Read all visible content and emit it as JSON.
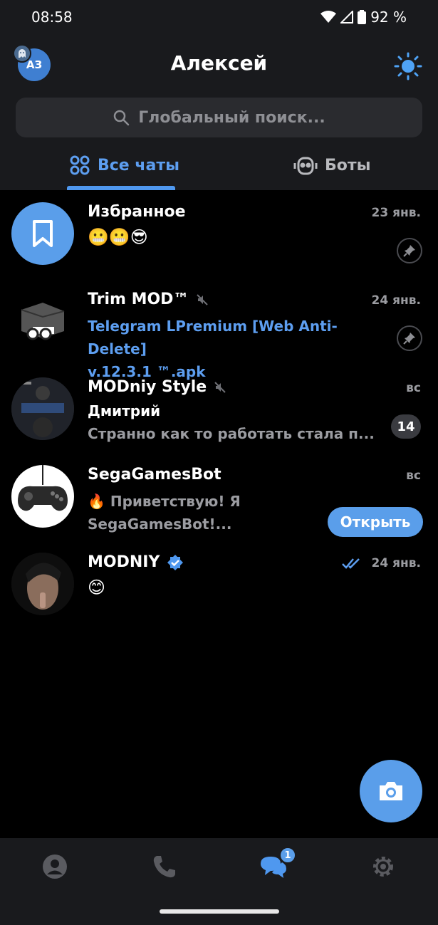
{
  "status": {
    "time": "08:58",
    "battery": "92 %"
  },
  "header": {
    "avatar_initials": "АЗ",
    "title": "Алексей"
  },
  "search": {
    "placeholder": "Глобальный поиск..."
  },
  "tabs": [
    {
      "label": "Все чаты",
      "active": true
    },
    {
      "label": "Боты",
      "active": false
    }
  ],
  "chats": [
    {
      "name": "Избранное",
      "date": "23 янв.",
      "preview": "😬😬😎",
      "pinned": true
    },
    {
      "name": "Trim MOD™",
      "date": "24 янв.",
      "muted": true,
      "pinned": true,
      "preview_line1": "Telegram LPremium [Web Anti-Delete]",
      "preview_line2": "v.12.3.1 ™.apk"
    },
    {
      "name": "MODniy Style",
      "date": "вс",
      "muted": true,
      "sender": "Дмитрий",
      "preview": "Странно как то работать стала п...",
      "unread": "14"
    },
    {
      "name": "SegaGamesBot",
      "date": "вс",
      "preview_line1": "🔥 Приветствую! Я",
      "preview_line2": "SegaGamesBot!...",
      "button": "Открыть"
    },
    {
      "name": "MODNIY",
      "date": "24 янв.",
      "verified": true,
      "read": true,
      "preview": "😊"
    }
  ],
  "bottom_nav": {
    "chats_badge": "1"
  },
  "colors": {
    "accent": "#5a9eea",
    "bg": "#000000",
    "panel": "#191a1d"
  }
}
